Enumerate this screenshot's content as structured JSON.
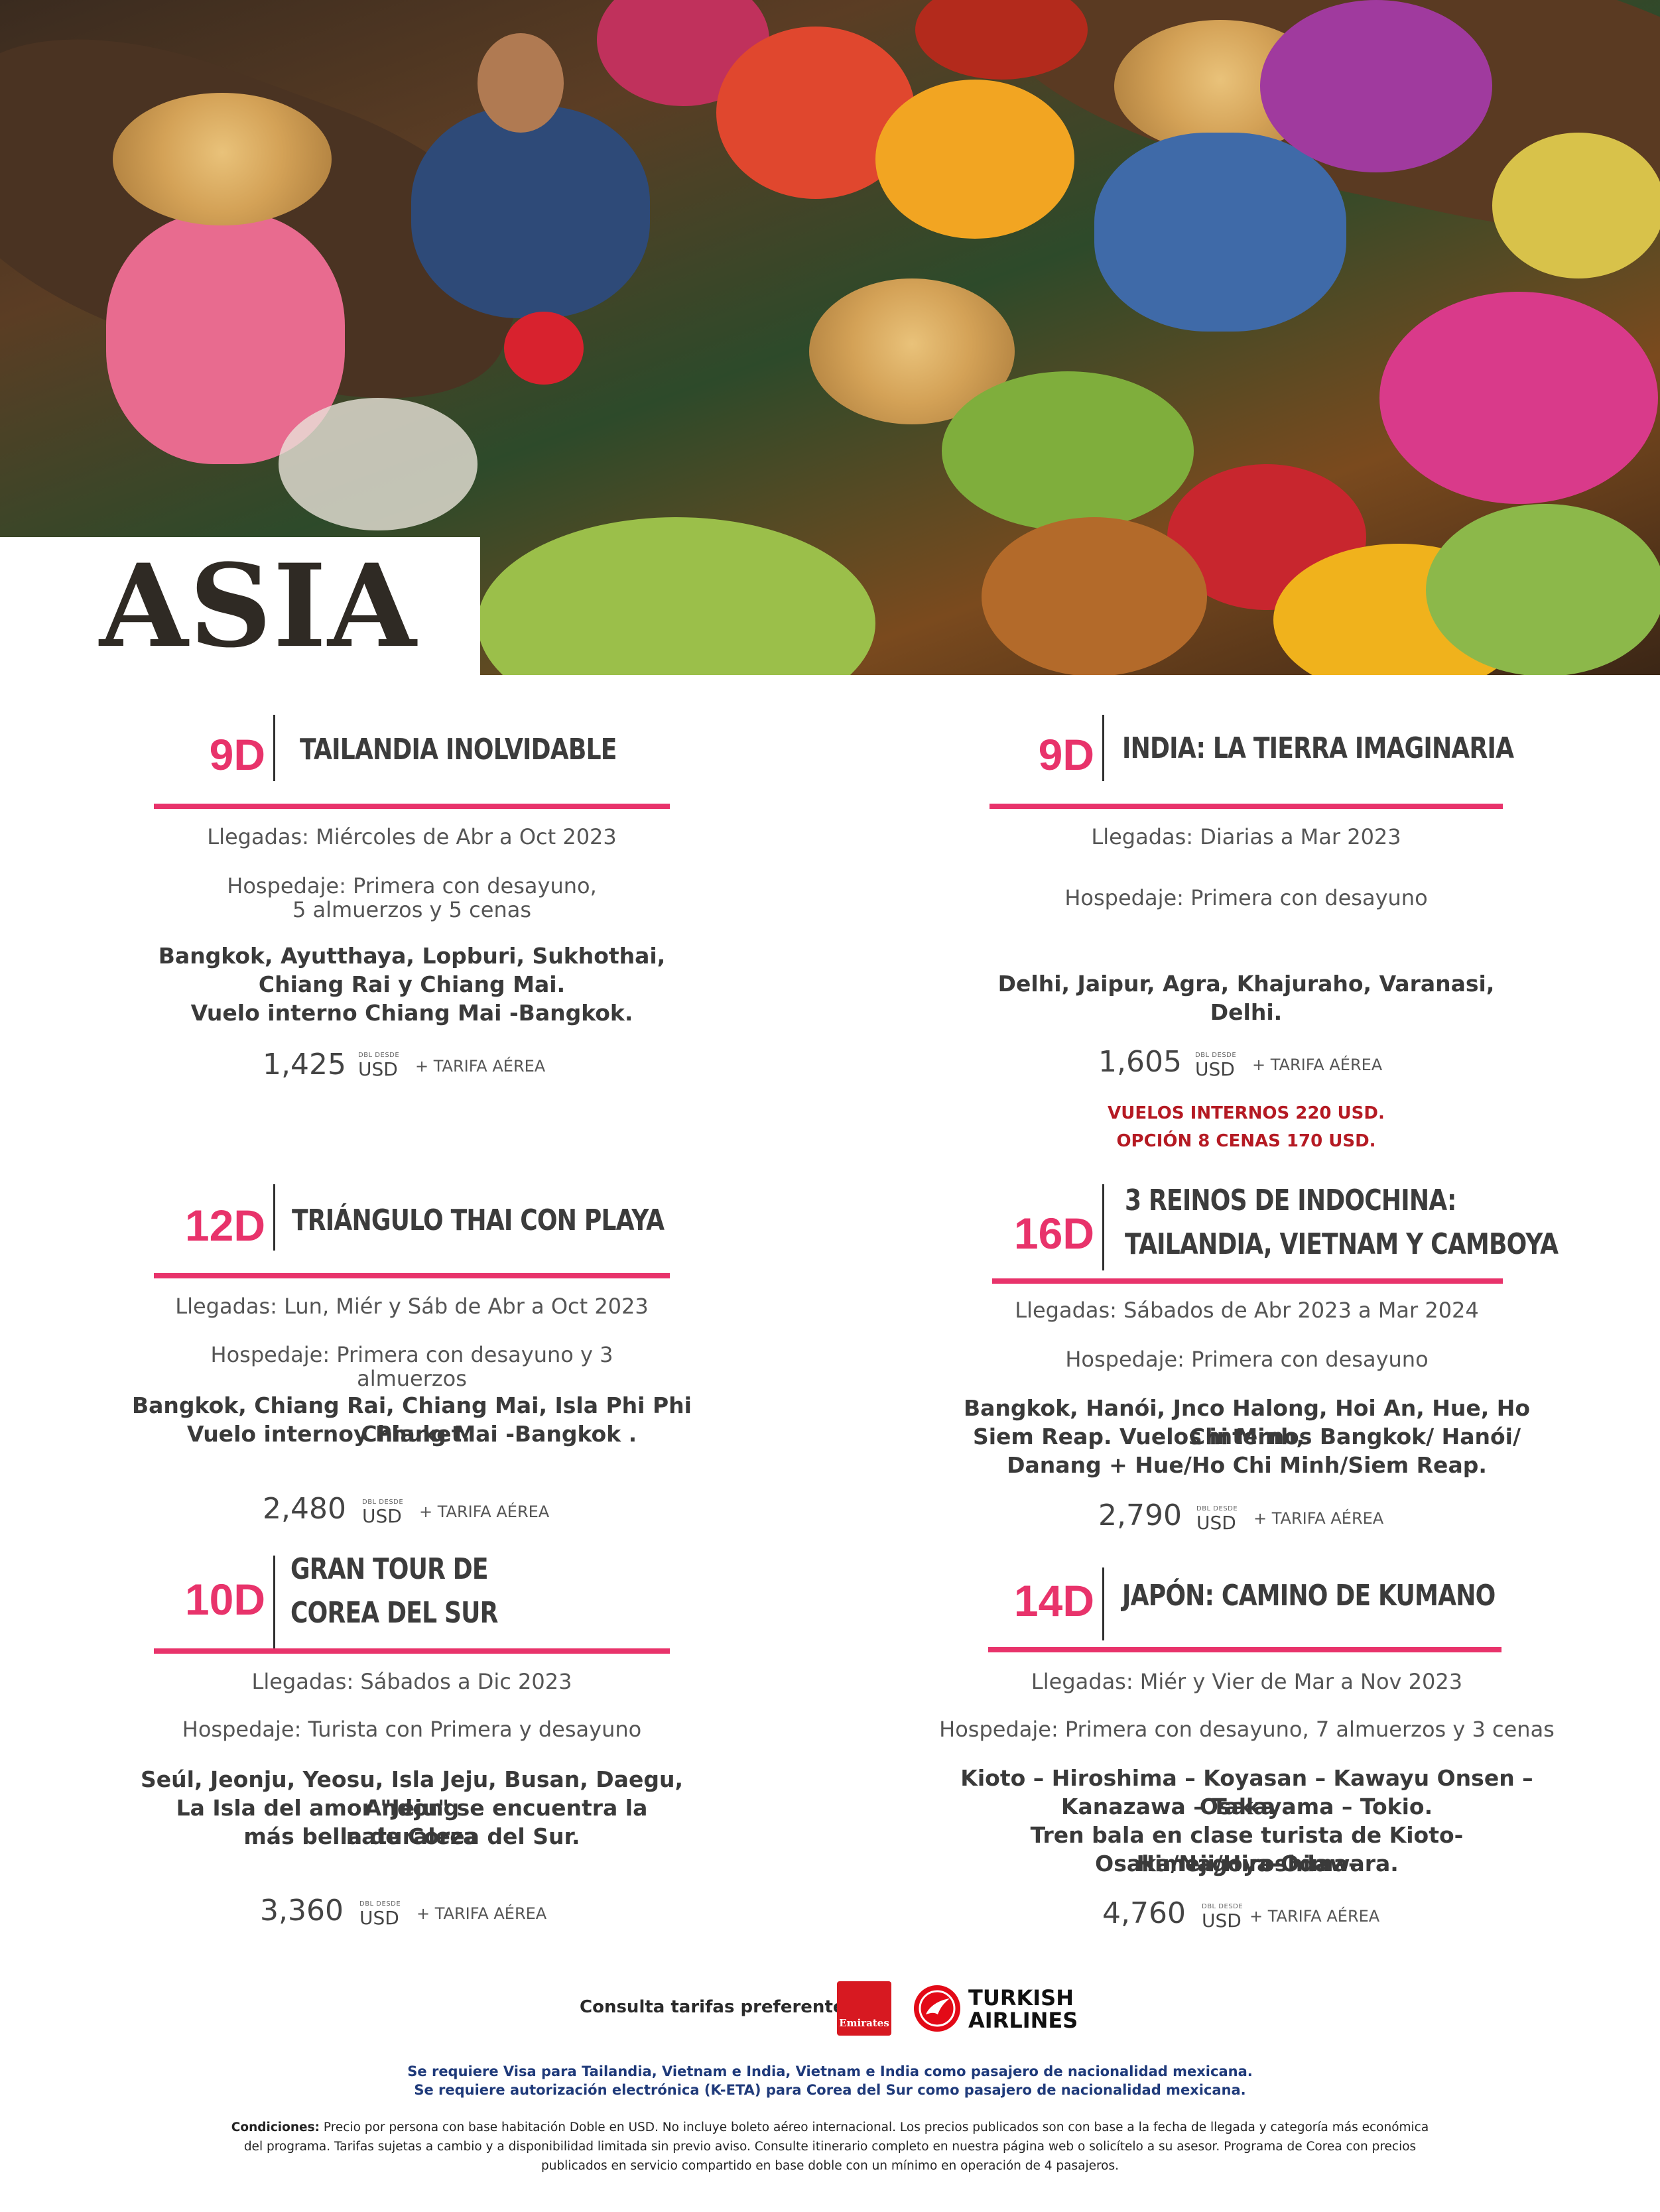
{
  "page": {
    "title": "ASIA"
  },
  "tours": [
    {
      "days": "9D",
      "name": [
        "TAILANDIA INOLVIDABLE"
      ],
      "llegadas": "Llegadas: Miércoles de Abr a Oct 2023",
      "hospedaje": [
        "Hospedaje: Primera con desayuno,",
        "5 almuerzos y 5 cenas"
      ],
      "cities": [
        "Bangkok, Ayutthaya, Lopburi, Sukhothai,",
        "Chiang Rai y Chiang Mai.",
        "Vuelo interno Chiang Mai -Bangkok."
      ],
      "price": "1,425",
      "price_label": "DBL DESDE",
      "currency": "USD",
      "tarifa": "+  TARIFA AÉREA"
    },
    {
      "days": "9D",
      "name": [
        "INDIA: LA TIERRA IMAGINARIA"
      ],
      "llegadas": "Llegadas: Diarias a Mar 2023",
      "hospedaje": [
        "Hospedaje: Primera con desayuno"
      ],
      "cities": [
        "Delhi, Jaipur, Agra, Khajuraho, Varanasi, Delhi."
      ],
      "price": "1,605",
      "price_label": "DBL DESDE",
      "currency": "USD",
      "tarifa": "+  TARIFA AÉREA",
      "notes": [
        "VUELOS INTERNOS 220 USD.",
        "OPCIÓN 8 CENAS 170 USD."
      ]
    },
    {
      "days": "12D",
      "name": [
        "TRIÁNGULO THAI CON PLAYA"
      ],
      "llegadas": "Llegadas: Lun, Miér y Sáb de Abr a Oct 2023",
      "hospedaje": [
        "Hospedaje: Primera con desayuno y 3 almuerzos"
      ],
      "cities": [
        "Bangkok, Chiang Rai, Chiang Mai, Isla Phi Phi y Phuket.",
        "Vuelo interno Chiang Mai -Bangkok ."
      ],
      "price": "2,480",
      "price_label": "DBL DESDE",
      "currency": "USD",
      "tarifa": "+  TARIFA AÉREA"
    },
    {
      "days": "16D",
      "name": [
        "3 REINOS DE INDOCHINA:",
        "TAILANDIA, VIETNAM Y CAMBOYA"
      ],
      "llegadas": "Llegadas: Sábados de Abr 2023 a Mar 2024",
      "hospedaje": [
        "Hospedaje: Primera con desayuno"
      ],
      "cities": [
        "Bangkok, Hanói, Jnco Halong, Hoi An, Hue, Ho Chi Minh,",
        "Siem Reap. Vuelos internos Bangkok/ Hanói/",
        "Danang + Hue/Ho Chi Minh/Siem Reap."
      ],
      "price": "2,790",
      "price_label": "DBL DESDE",
      "currency": "USD",
      "tarifa": "+  TARIFA AÉREA"
    },
    {
      "days": "10D",
      "name": [
        "GRAN TOUR DE",
        "COREA DEL SUR"
      ],
      "llegadas": "Llegadas: Sábados a Dic 2023",
      "hospedaje": [
        "Hospedaje: Turista con Primera y desayuno"
      ],
      "cities": [
        "Seúl, Jeonju, Yeosu, Isla Jeju, Busan, Daegu, Andong",
        "La Isla del amor \"Jeju\" se encuentra la naturaleza",
        "más bella de Corea del Sur."
      ],
      "price": "3,360",
      "price_label": "DBL DESDE",
      "currency": "USD",
      "tarifa": "+  TARIFA AÉREA"
    },
    {
      "days": "14D",
      "name": [
        "JAPÓN: CAMINO DE KUMANO"
      ],
      "llegadas": "Llegadas: Miér y Vier de Mar a Nov 2023",
      "hospedaje": [
        "Hospedaje: Primera con desayuno, 7 almuerzos y 3 cenas"
      ],
      "cities": [
        "Kioto – Hiroshima – Koyasan – Kawayu Onsen – Osaka –",
        "Kanazawa – Takayama – Tokio.",
        "Tren bala en clase turista de Kioto-Himeji/Hiroshima-",
        "Osaka/Nagoya-Odawara."
      ],
      "price": "4,760",
      "price_label": "DBL DESDE",
      "currency": "USD",
      "tarifa": "+ TARIFA AÉREA"
    }
  ],
  "footer": {
    "consulta": "Consulta tarifas preferentes",
    "emirates_logo": "Emirates",
    "turkish_logo": [
      "TURKISH",
      "AIRLINES"
    ],
    "visa": [
      "Se requiere Visa para Tailandia, Vietnam e India, Vietnam e India como pasajero de nacionalidad mexicana.",
      "Se requiere autorización electrónica (K-ETA) para Corea del Sur como pasajero de nacionalidad mexicana."
    ],
    "conditions_label": "Condiciones:",
    "conditions": [
      " Precio por persona con base habitación Doble en USD. No incluye boleto aéreo internacional. Los precios publicados son con base a la fecha de llegada y categoría más económica",
      "del programa. Tarifas sujetas a cambio y a disponibilidad limitada sin previo aviso. Consulte itinerario completo en nuestra página web o solicítelo a su asesor. Programa de Corea con precios",
      "publicados en servicio compartido en base doble con un mínimo en operación de 4 pasajeros."
    ]
  },
  "colors": {
    "accent": "#e8336b",
    "note_red": "#b51a23",
    "visa_blue": "#1f3a7a"
  }
}
